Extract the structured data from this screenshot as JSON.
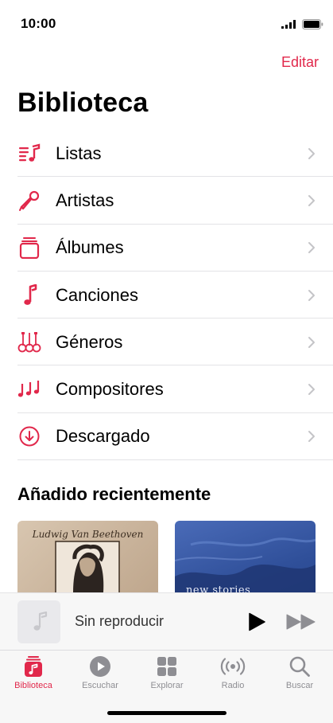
{
  "status": {
    "time": "10:00"
  },
  "header": {
    "edit_label": "Editar",
    "title": "Biblioteca"
  },
  "library": {
    "items": [
      {
        "label": "Listas",
        "icon": "playlists-icon"
      },
      {
        "label": "Artistas",
        "icon": "microphone-icon"
      },
      {
        "label": "Álbumes",
        "icon": "albums-icon"
      },
      {
        "label": "Canciones",
        "icon": "music-note-icon"
      },
      {
        "label": "Géneros",
        "icon": "genres-icon"
      },
      {
        "label": "Compositores",
        "icon": "composers-icon"
      },
      {
        "label": "Descargado",
        "icon": "download-icon"
      }
    ]
  },
  "recent": {
    "title": "Añadido recientemente",
    "albums": [
      {
        "cover_text": "Ludwig Van Beethoven"
      },
      {
        "cover_text": "new stories"
      }
    ]
  },
  "player": {
    "title": "Sin reproducir"
  },
  "tabs": [
    {
      "label": "Biblioteca",
      "icon": "library-icon",
      "active": true
    },
    {
      "label": "Escuchar",
      "icon": "play-circle-icon",
      "active": false
    },
    {
      "label": "Explorar",
      "icon": "browse-grid-icon",
      "active": false
    },
    {
      "label": "Radio",
      "icon": "radio-icon",
      "active": false
    },
    {
      "label": "Buscar",
      "icon": "search-icon",
      "active": false
    }
  ],
  "colors": {
    "accent": "#e1284b",
    "inactive": "#8e8e93"
  }
}
